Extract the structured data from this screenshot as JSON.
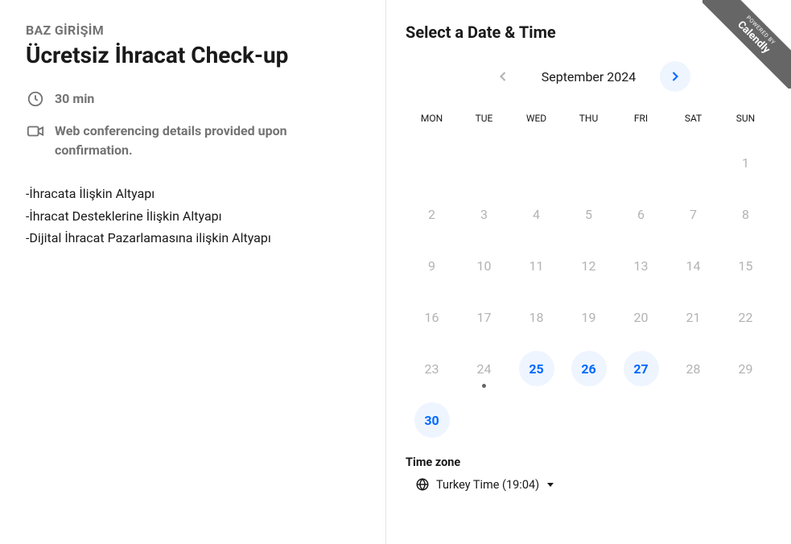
{
  "left": {
    "organizer": "BAZ GİRİŞİM",
    "title": "Ücretsiz İhracat Check-up",
    "duration": "30 min",
    "conference_note": "Web conferencing details provided upon confirmation.",
    "description_lines": [
      "-İhracata İlişkin Altyapı",
      "-İhracat Desteklerine İlişkin Altyapı",
      "-Dijital İhracat Pazarlamasına ilişkin Altyapı"
    ]
  },
  "right": {
    "heading": "Select a Date & Time",
    "month_label": "September 2024",
    "weekdays": [
      "MON",
      "TUE",
      "WED",
      "THU",
      "FRI",
      "SAT",
      "SUN"
    ],
    "days": [
      {
        "n": "",
        "available": false,
        "today": false,
        "blank": true
      },
      {
        "n": "",
        "available": false,
        "today": false,
        "blank": true
      },
      {
        "n": "",
        "available": false,
        "today": false,
        "blank": true
      },
      {
        "n": "",
        "available": false,
        "today": false,
        "blank": true
      },
      {
        "n": "",
        "available": false,
        "today": false,
        "blank": true
      },
      {
        "n": "",
        "available": false,
        "today": false,
        "blank": true
      },
      {
        "n": "1",
        "available": false,
        "today": false
      },
      {
        "n": "2",
        "available": false,
        "today": false
      },
      {
        "n": "3",
        "available": false,
        "today": false
      },
      {
        "n": "4",
        "available": false,
        "today": false
      },
      {
        "n": "5",
        "available": false,
        "today": false
      },
      {
        "n": "6",
        "available": false,
        "today": false
      },
      {
        "n": "7",
        "available": false,
        "today": false
      },
      {
        "n": "8",
        "available": false,
        "today": false
      },
      {
        "n": "9",
        "available": false,
        "today": false
      },
      {
        "n": "10",
        "available": false,
        "today": false
      },
      {
        "n": "11",
        "available": false,
        "today": false
      },
      {
        "n": "12",
        "available": false,
        "today": false
      },
      {
        "n": "13",
        "available": false,
        "today": false
      },
      {
        "n": "14",
        "available": false,
        "today": false
      },
      {
        "n": "15",
        "available": false,
        "today": false
      },
      {
        "n": "16",
        "available": false,
        "today": false
      },
      {
        "n": "17",
        "available": false,
        "today": false
      },
      {
        "n": "18",
        "available": false,
        "today": false
      },
      {
        "n": "19",
        "available": false,
        "today": false
      },
      {
        "n": "20",
        "available": false,
        "today": false
      },
      {
        "n": "21",
        "available": false,
        "today": false
      },
      {
        "n": "22",
        "available": false,
        "today": false
      },
      {
        "n": "23",
        "available": false,
        "today": false
      },
      {
        "n": "24",
        "available": false,
        "today": true
      },
      {
        "n": "25",
        "available": true,
        "today": false
      },
      {
        "n": "26",
        "available": true,
        "today": false
      },
      {
        "n": "27",
        "available": true,
        "today": false
      },
      {
        "n": "28",
        "available": false,
        "today": false
      },
      {
        "n": "29",
        "available": false,
        "today": false
      },
      {
        "n": "30",
        "available": true,
        "today": false
      }
    ],
    "timezone_label": "Time zone",
    "timezone_value": "Turkey Time (19:04)"
  },
  "ribbon": {
    "powered": "POWERED BY",
    "brand": "Calendly"
  }
}
